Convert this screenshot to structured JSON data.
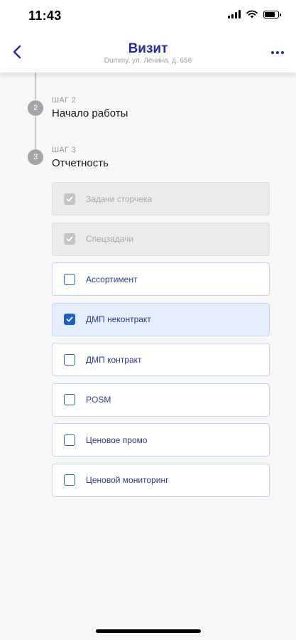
{
  "status_bar": {
    "time": "11:43",
    "battery_level": 0.85
  },
  "header": {
    "title": "Визит",
    "subtitle": "Dummy, ул. Ленина, д. 656",
    "back_icon": "chevron-left-icon",
    "more_icon": "more-dots-icon",
    "accent_color": "#1f2ba0"
  },
  "steps": [
    {
      "number": "2",
      "label": "ШАГ 2",
      "title": "Начало работы"
    },
    {
      "number": "3",
      "label": "ШАГ 3",
      "title": "Отчетность"
    }
  ],
  "tasks": [
    {
      "label": "Задачи сторчека",
      "checked": true,
      "disabled": true
    },
    {
      "label": "Спецзадачи",
      "checked": true,
      "disabled": true
    },
    {
      "label": "Ассортимент",
      "checked": false,
      "disabled": false
    },
    {
      "label": "ДМП неконтракт",
      "checked": true,
      "disabled": false
    },
    {
      "label": "ДМП контракт",
      "checked": false,
      "disabled": false
    },
    {
      "label": "POSM",
      "checked": false,
      "disabled": false
    },
    {
      "label": "Ценовое промо",
      "checked": false,
      "disabled": false
    },
    {
      "label": "Ценовой мониторинг",
      "checked": false,
      "disabled": false
    }
  ],
  "colors": {
    "checkbox_accent": "#1c5fd1",
    "checked_row_bg": "#e4eefd",
    "disabled_row_bg": "#ebebec"
  }
}
